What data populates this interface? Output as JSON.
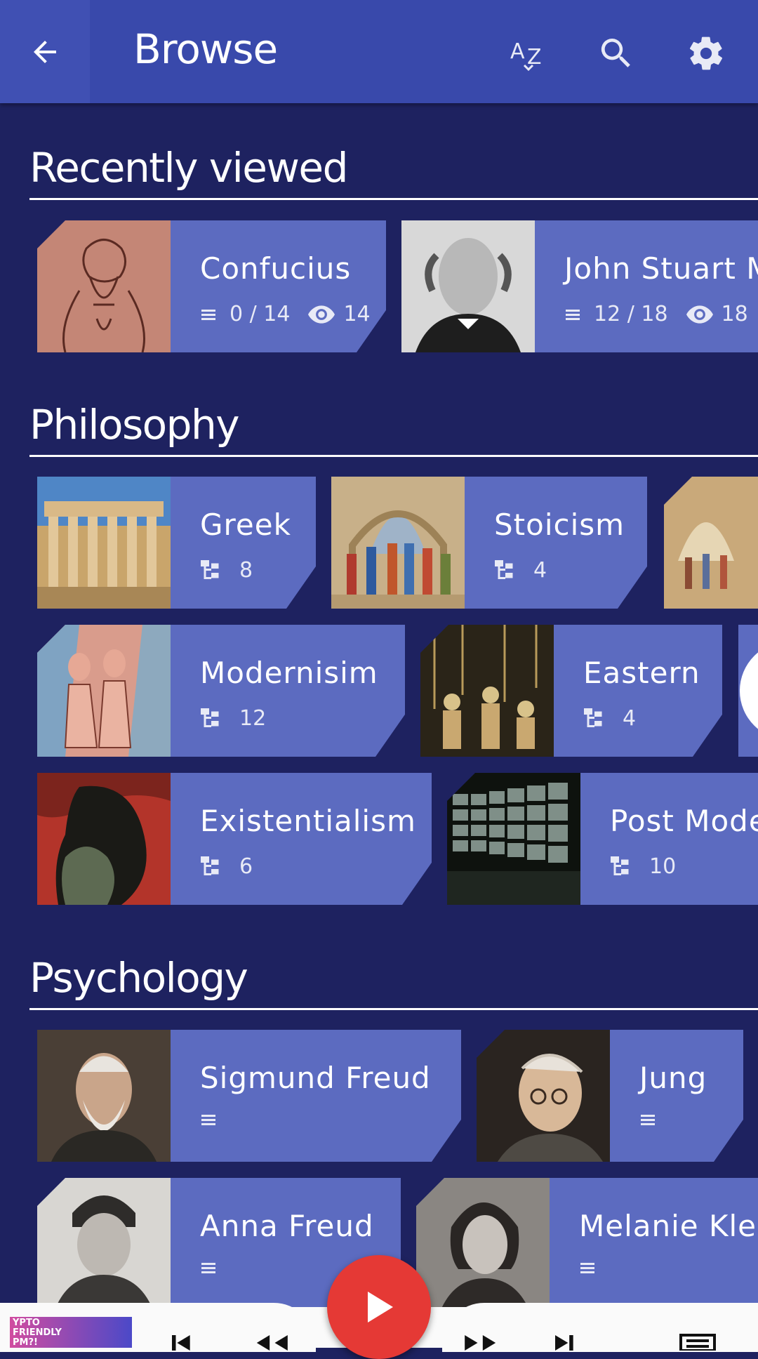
{
  "appbar": {
    "title": "Browse",
    "icons": [
      "back-arrow-icon",
      "sort-az-icon",
      "search-icon",
      "settings-icon"
    ]
  },
  "recent": {
    "heading": "Recently viewed",
    "items": [
      {
        "name": "Confucius",
        "progress": "0 / 14",
        "views": "14"
      },
      {
        "name": "John Stuart M",
        "progress": "12 / 18",
        "views": "18"
      }
    ]
  },
  "philosophy": {
    "heading": "Philosophy",
    "items": [
      {
        "name": "Greek",
        "count": "8"
      },
      {
        "name": "Stoicism",
        "count": "4"
      },
      {
        "name": "Modernisim",
        "count": "12"
      },
      {
        "name": "Eastern",
        "count": "4"
      },
      {
        "name": "Existentialism",
        "count": "6"
      },
      {
        "name": "Post Mode",
        "count": "10"
      }
    ]
  },
  "psychology": {
    "heading": "Psychology",
    "items": [
      {
        "name": "Sigmund Freud"
      },
      {
        "name": "Jung"
      },
      {
        "name": "Anna Freud"
      },
      {
        "name": "Melanie Klei"
      }
    ]
  },
  "player": {
    "thumb_text": "YPTO FRIENDLY PM?!",
    "play_icon": "play-icon"
  },
  "colors": {
    "appbar": "#3949ab",
    "background": "#1e2260",
    "card": "#5c6bc0",
    "fab": "#e53935"
  }
}
